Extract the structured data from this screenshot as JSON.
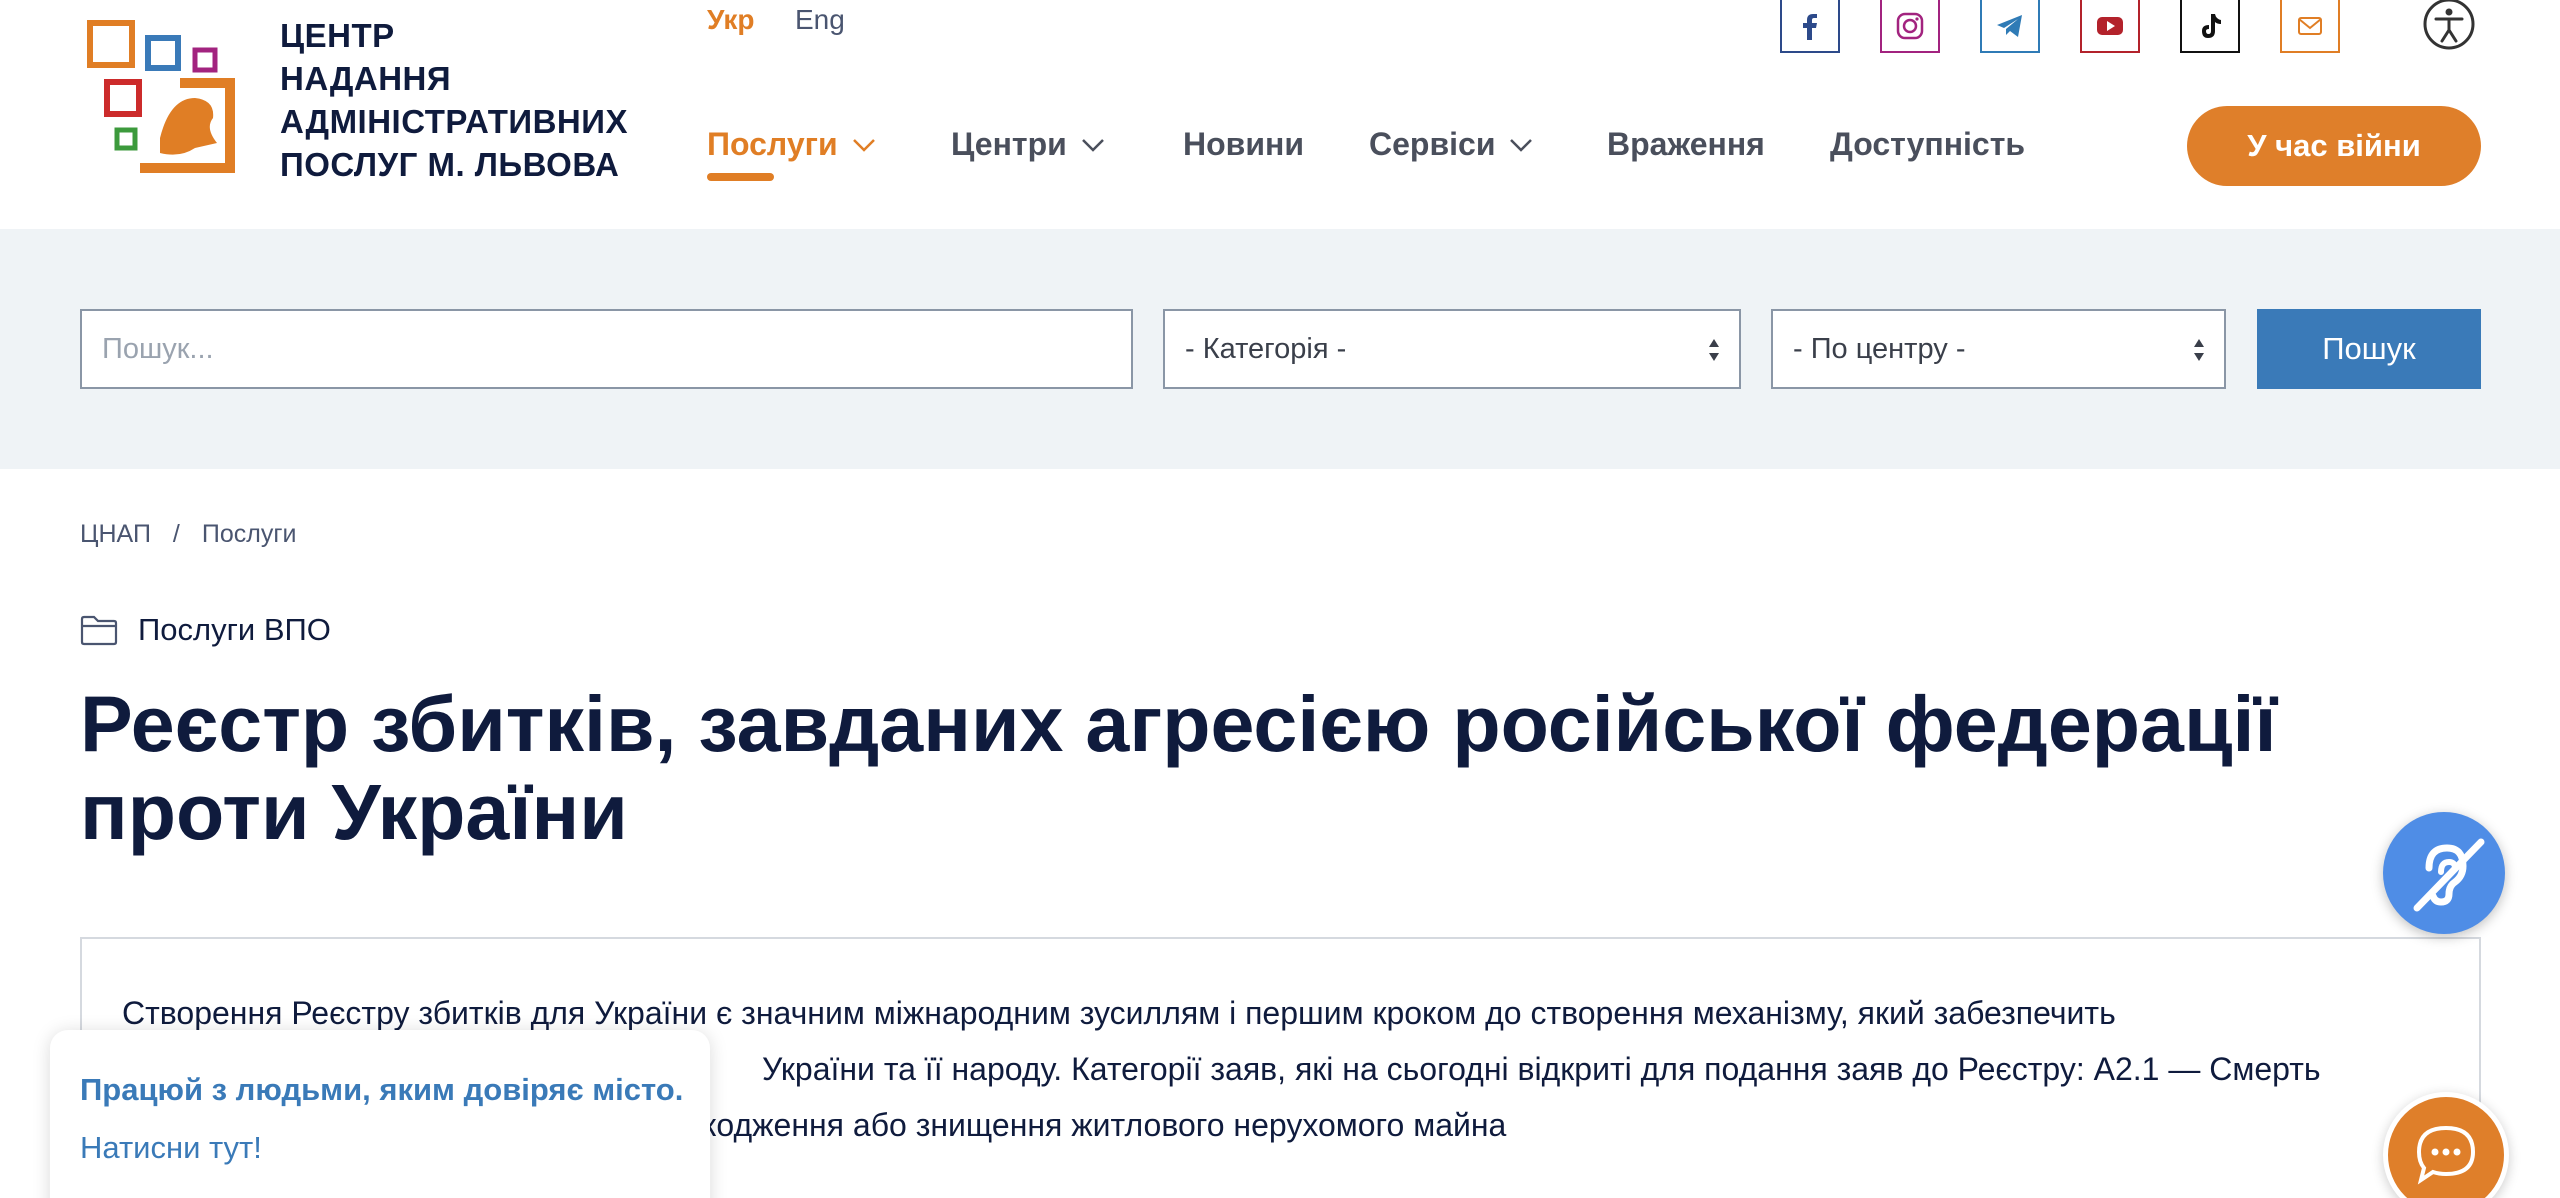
{
  "header": {
    "logo_lines": [
      "ЦЕНТР",
      "НАДАННЯ",
      "АДМІНІСТРАТИВНИХ",
      "ПОСЛУГ М. ЛЬВОВА"
    ],
    "languages": [
      {
        "label": "Укр",
        "active": true
      },
      {
        "label": "Eng",
        "active": false
      }
    ],
    "nav": [
      {
        "label": "Послуги",
        "dropdown": true,
        "active": true
      },
      {
        "label": "Центри",
        "dropdown": true,
        "active": false
      },
      {
        "label": "Новини",
        "dropdown": false,
        "active": false
      },
      {
        "label": "Сервіси",
        "dropdown": true,
        "active": false
      },
      {
        "label": "Враження",
        "dropdown": false,
        "active": false
      },
      {
        "label": "Доступність",
        "dropdown": false,
        "active": false
      }
    ],
    "social": [
      {
        "name": "facebook-icon",
        "color": "#2d4a8a"
      },
      {
        "name": "instagram-icon",
        "color": "#a2237f"
      },
      {
        "name": "telegram-icon",
        "color": "#2f7bb6"
      },
      {
        "name": "youtube-icon",
        "color": "#b3222b"
      },
      {
        "name": "tiktok-icon",
        "color": "#111111"
      },
      {
        "name": "mail-icon",
        "color": "#e07e25"
      }
    ],
    "accessibility_icon": "accessibility-icon",
    "war_button": "У час війни"
  },
  "search": {
    "placeholder": "Пошук...",
    "category_select": "- Категорія -",
    "center_select": "- По центру -",
    "button": "Пошук"
  },
  "breadcrumb": [
    "ЦНАП",
    "Послуги"
  ],
  "breadcrumb_separator": "/",
  "category": "Послуги ВПО",
  "title": "Реєстр збитків, завданих агресією російської федерації проти України",
  "content_lines": [
    "Створення Реєстру збитків для України є значним міжнародним зусиллям і першим кроком до створення механізму, який забезпечить",
    "Україн​и та її народу. Категорії заяв, які на сьогодні відкриті для подання заяв до Реєстру: А2.1 — Смерть",
    "кодження або знищення житлового нерухомого майна"
  ],
  "popup": {
    "line1": "Працюй з людьми, яким довіряє місто.",
    "line2": "Натисни тут!"
  },
  "colors": {
    "accent_orange": "#e07e25",
    "primary_blue": "#3a7ab8",
    "navy": "#0f1b3d",
    "search_band": "#eff3f6"
  }
}
